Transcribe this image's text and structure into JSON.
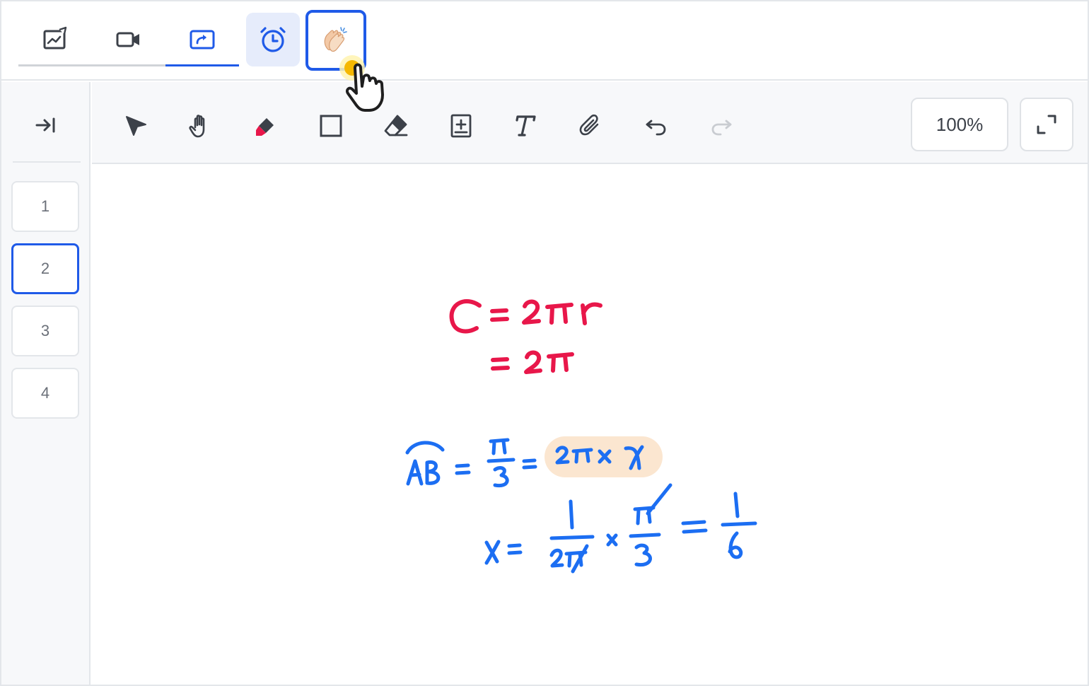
{
  "topbar": {
    "tabs": [
      {
        "id": "whiteboard",
        "icon": "whiteboard-chart-icon"
      },
      {
        "id": "video",
        "icon": "video-camera-icon"
      },
      {
        "id": "screen-share",
        "icon": "screen-share-icon"
      },
      {
        "id": "timer",
        "icon": "alarm-clock-icon"
      },
      {
        "id": "applause",
        "icon": "clapping-hands-icon"
      }
    ],
    "active_tab": "screen-share",
    "colors": {
      "accent": "#1f5ae8",
      "timer_bg": "#e6ecfb",
      "inactive_underline": "#d0d3d8"
    }
  },
  "rail": {
    "collapse_icon": "collapse-right-icon",
    "pages": [
      "1",
      "2",
      "3",
      "4"
    ],
    "active_page": "2"
  },
  "toolbar": {
    "tools": [
      {
        "id": "select",
        "icon": "pointer-arrow-icon"
      },
      {
        "id": "pan",
        "icon": "hand-icon"
      },
      {
        "id": "highlighter",
        "icon": "highlighter-icon"
      },
      {
        "id": "rectangle",
        "icon": "rectangle-icon"
      },
      {
        "id": "eraser",
        "icon": "eraser-icon"
      },
      {
        "id": "add-page",
        "icon": "add-page-icon"
      },
      {
        "id": "text",
        "icon": "text-tool-icon"
      },
      {
        "id": "attach",
        "icon": "paperclip-icon"
      },
      {
        "id": "undo",
        "icon": "undo-icon"
      },
      {
        "id": "redo",
        "icon": "redo-icon",
        "disabled": true
      }
    ],
    "zoom": "100%",
    "fullscreen_icon": "fullscreen-icon"
  },
  "canvas": {
    "ink_colors": {
      "red": "#e8174a",
      "blue": "#1c6ef2",
      "highlight": "#fbe6d0"
    }
  }
}
